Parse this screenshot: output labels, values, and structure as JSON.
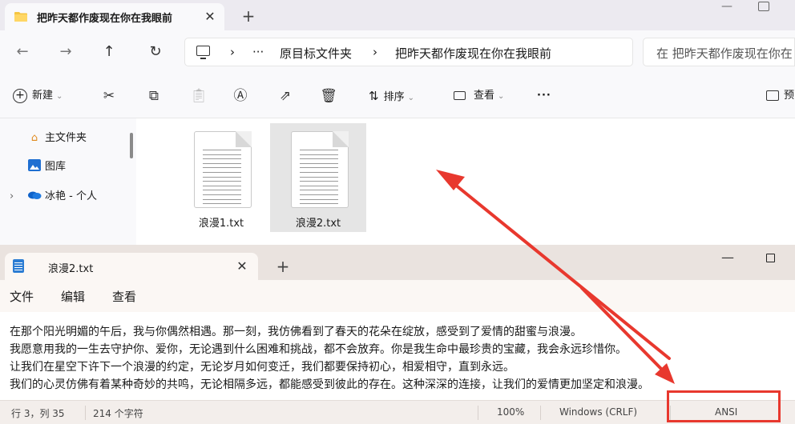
{
  "explorer": {
    "tab_title": "把昨天都作废现在你在我眼前",
    "tab_close": "✕",
    "new_tab": "+",
    "window_min": "—",
    "address": {
      "back": "←",
      "forward": "→",
      "up": "↑",
      "refresh": "↻",
      "chevron": "›",
      "ellipsis": "···",
      "crumbs": [
        "原目标文件夹",
        "把昨天都作废现在你在我眼前"
      ],
      "search_placeholder": "在 把昨天都作废现在你在"
    },
    "toolbar": {
      "new_label": "新建",
      "sort_label": "排序",
      "view_label": "查看",
      "more": "···",
      "preview_label": "预",
      "icons": [
        "cut-icon",
        "copy-icon",
        "paste-icon",
        "rename-icon",
        "share-icon",
        "delete-icon"
      ]
    },
    "nav": [
      {
        "label": "主文件夹",
        "icon": "home-icon"
      },
      {
        "label": "图库",
        "icon": "gallery-icon"
      },
      {
        "label": "冰艳 - 个人",
        "icon": "onedrive-icon"
      }
    ],
    "nav_expand": "›",
    "files": [
      {
        "name": "浪漫1.txt",
        "selected": false
      },
      {
        "name": "浪漫2.txt",
        "selected": true
      }
    ]
  },
  "notepad": {
    "tab_title": "浪漫2.txt",
    "tab_close": "✕",
    "new_tab": "+",
    "window_min": "—",
    "menu": [
      "文件",
      "编辑",
      "查看"
    ],
    "lines": [
      "在那个阳光明媚的午后，我与你偶然相遇。那一刻，我仿佛看到了春天的花朵在绽放，感受到了爱情的甜蜜与浪漫。",
      "我愿意用我的一生去守护你、爱你，无论遇到什么困难和挑战，都不会放弃。你是我生命中最珍贵的宝藏，我会永远珍惜你。",
      "让我们在星空下许下一个浪漫的约定，无论岁月如何变迁，我们都要保持初心，相爱相守，直到永远。",
      "我们的心灵仿佛有着某种奇妙的共鸣，无论相隔多远，都能感受到彼此的存在。这种深深的连接，让我们的爱情更加坚定和浪漫。"
    ],
    "status": {
      "position": "行 3，列 35",
      "char_count": "214 个字符",
      "zoom": "100%",
      "line_ending": "Windows (CRLF)",
      "encoding": "ANSI"
    }
  },
  "annotations": {
    "color": "#e8382e"
  }
}
